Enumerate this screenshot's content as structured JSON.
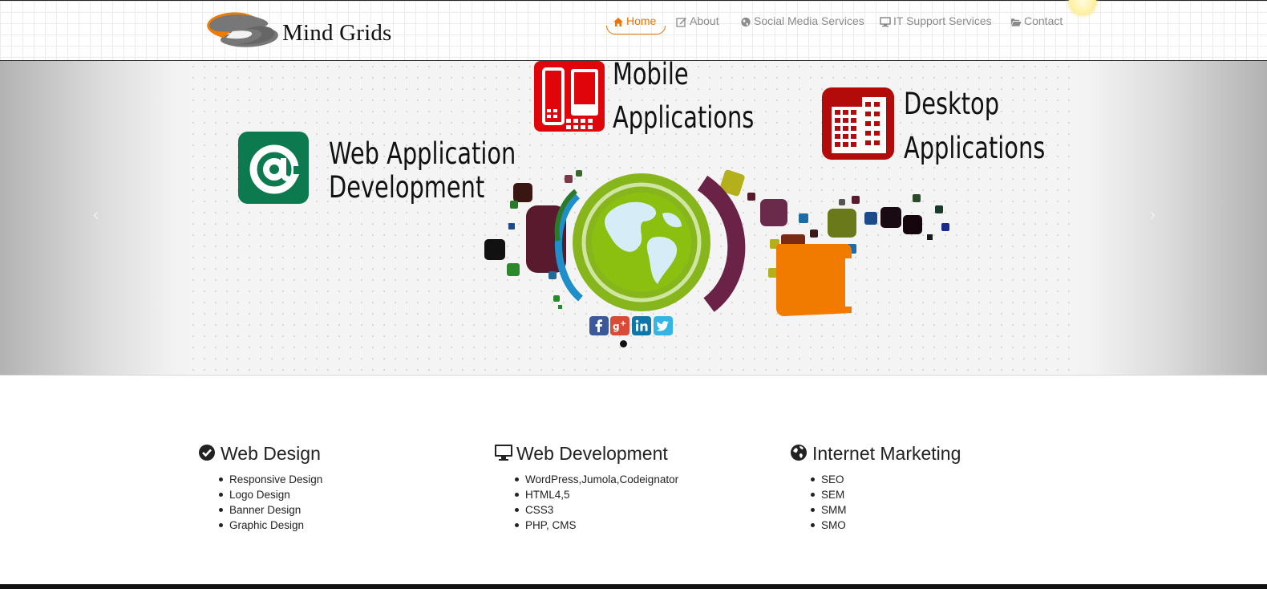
{
  "brand": {
    "name": "Mind Grids"
  },
  "nav": {
    "items": [
      {
        "label": "Home",
        "icon": "home-icon",
        "active": true
      },
      {
        "label": "About",
        "icon": "edit-icon",
        "active": false
      },
      {
        "label": "Social Media Services",
        "icon": "globe-icon",
        "active": false
      },
      {
        "label": "IT Support Services",
        "icon": "monitor-icon",
        "active": false
      },
      {
        "label": "Contact",
        "icon": "folder-open-icon",
        "active": false
      }
    ]
  },
  "carousel": {
    "titles": {
      "web_app": [
        "Web Application",
        "Development"
      ],
      "mobile": [
        "Mobile",
        "Applications"
      ],
      "desktop": [
        "Desktop",
        "Applications"
      ]
    },
    "social_icons": [
      "facebook-icon",
      "google-plus-icon",
      "linkedin-icon",
      "twitter-icon"
    ],
    "prev_label": "‹",
    "next_label": "›",
    "indicator_count": 1,
    "active_indicator": 1
  },
  "features": [
    {
      "title": "Web Design",
      "icon": "check-circle-icon",
      "items": [
        "Responsive Design",
        "Logo Design",
        "Banner Design",
        "Graphic Design"
      ]
    },
    {
      "title": "Web Development",
      "icon": "desktop-icon",
      "items": [
        "WordPress,Jumola,Codeignator",
        "HTML4,5",
        "CSS3",
        "PHP, CMS"
      ]
    },
    {
      "title": "Internet Marketing",
      "icon": "globe-icon",
      "items": [
        "SEO",
        "SEM",
        "SMM",
        "SMO"
      ]
    }
  ],
  "colors": {
    "accent": "#ee7300",
    "nav_text": "#8a8a8a",
    "web_app_icon": "#0c7a4e",
    "mobile_icon": "#e0040b",
    "desktop_icon": "#b30a0a",
    "globe": "#8cb61c",
    "orange_square": "#f07b00"
  }
}
